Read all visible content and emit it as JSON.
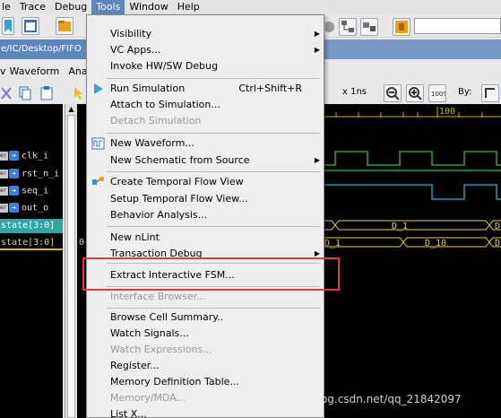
{
  "menubar": {
    "items": [
      {
        "label": "le"
      },
      {
        "label": "Trace"
      },
      {
        "label": "Debug"
      },
      {
        "label": "Tools"
      },
      {
        "label": "Window"
      },
      {
        "label": "Help"
      }
    ]
  },
  "pathbar": {
    "text": "e/IC/Desktop/FIFO"
  },
  "wave_menubar": {
    "items": [
      {
        "label": "Waveform"
      },
      {
        "label": "Ana"
      }
    ]
  },
  "toolbar": {
    "zoom_label": "x 1ns",
    "by_label": "By:",
    "zoom_fit_label": "100%"
  },
  "signals": [
    {
      "name": "clk_i",
      "tag": "er"
    },
    {
      "name": "rst_n_i",
      "tag": "er"
    },
    {
      "name": "seq_i",
      "tag": "er"
    },
    {
      "name": "out_o",
      "tag": "er"
    },
    {
      "name": "state[3:0]"
    },
    {
      "name": "state[3:0]"
    }
  ],
  "value_column": {
    "bus2_value": "0"
  },
  "waveform": {
    "ruler_mark": "100",
    "bus1_values": [
      "D_1",
      "D"
    ],
    "bus2_values": [
      "D_1",
      "D_10",
      "D"
    ]
  },
  "tools_menu": {
    "items": [
      {
        "label": "Visibility",
        "submenu": true
      },
      {
        "label": "VC Apps...",
        "submenu": true
      },
      {
        "label": "Invoke HW/SW Debug"
      },
      {
        "label": "Run Simulation",
        "shortcut": "Ctrl+Shift+R",
        "icon": "play-icon"
      },
      {
        "label": "Attach to Simulation..."
      },
      {
        "label": "Detach Simulation",
        "disabled": true
      },
      {
        "label": "New Waveform...",
        "icon": "waveform-icon"
      },
      {
        "label": "New Schematic from Source",
        "submenu": true
      },
      {
        "label": "Create Temporal Flow View",
        "icon": "flow-icon"
      },
      {
        "label": "Setup Temporal Flow View..."
      },
      {
        "label": "Behavior Analysis..."
      },
      {
        "label": "New nLint"
      },
      {
        "label": "Transaction Debug",
        "submenu": true
      },
      {
        "label": "Extract Interactive FSM..."
      },
      {
        "label": "Interface Browser...",
        "disabled": true
      },
      {
        "label": "Browse Cell Summary.."
      },
      {
        "label": "Watch Signals..."
      },
      {
        "label": "Watch Expressions...",
        "disabled": true
      },
      {
        "label": "Register..."
      },
      {
        "label": "Memory Definition Table..."
      },
      {
        "label": "Memory/MDA...",
        "disabled": true
      },
      {
        "label": "List X..."
      }
    ]
  },
  "watermark": {
    "text": "https://blog.csdn.net/qq_21842097"
  },
  "colors": {
    "menu_active": "#5c86bd",
    "highlight_border": "#e63a3a",
    "wave_green": "#26c04a",
    "wave_cyan": "#20b8d8",
    "bus_teal": "#32a6a6",
    "bus_yellow": "#e6d15a"
  }
}
